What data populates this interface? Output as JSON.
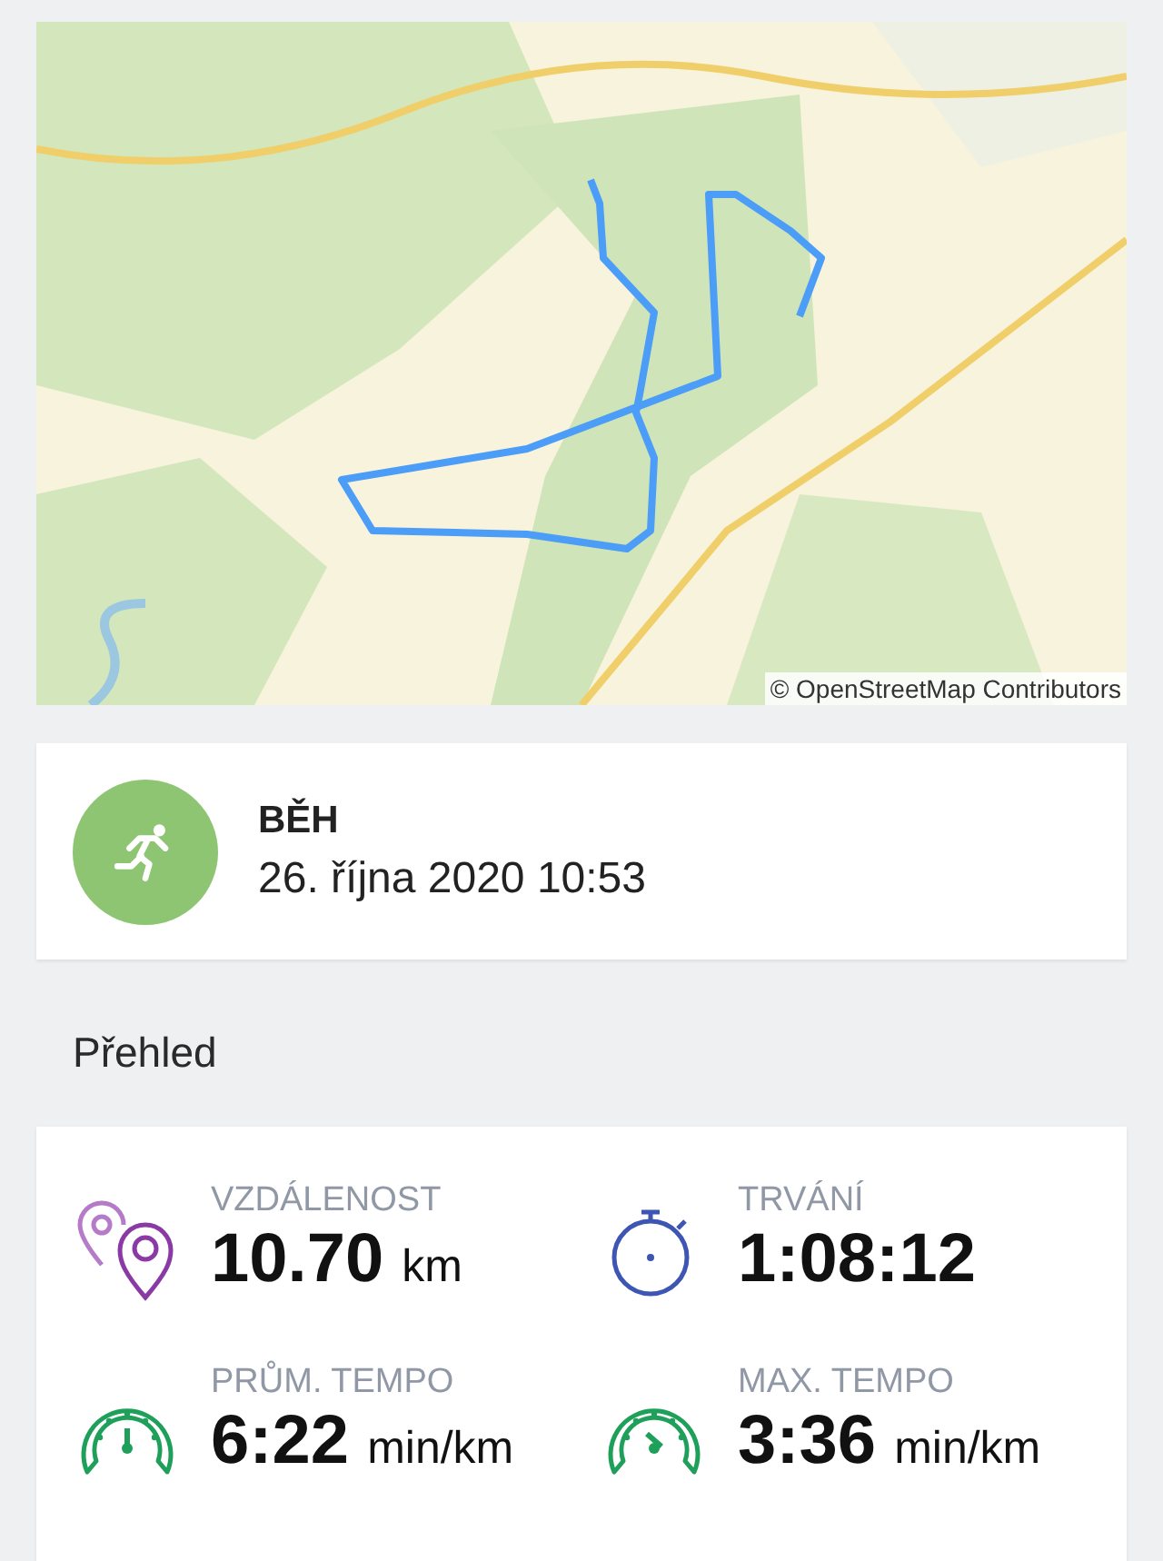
{
  "map": {
    "kind": "picture",
    "attribution": "© OpenStreetMap Contributors"
  },
  "activity": {
    "type": "BĚH",
    "datetime": "26. října 2020 10:53",
    "color": "#8dc572"
  },
  "section_title": "Přehled",
  "stats": [
    {
      "kind": "distance",
      "label": "VZDÁLENOST",
      "value": "10.70",
      "unit": "km"
    },
    {
      "kind": "duration",
      "label": "TRVÁNÍ",
      "value": "1:08:12"
    },
    {
      "kind": "pace_avg",
      "label": "PRŮM. TEMPO",
      "value": "6:22",
      "unit": "min/km"
    },
    {
      "kind": "pace_max",
      "label": "MAX. TEMPO",
      "value": "3:36",
      "unit": "min/km"
    }
  ]
}
